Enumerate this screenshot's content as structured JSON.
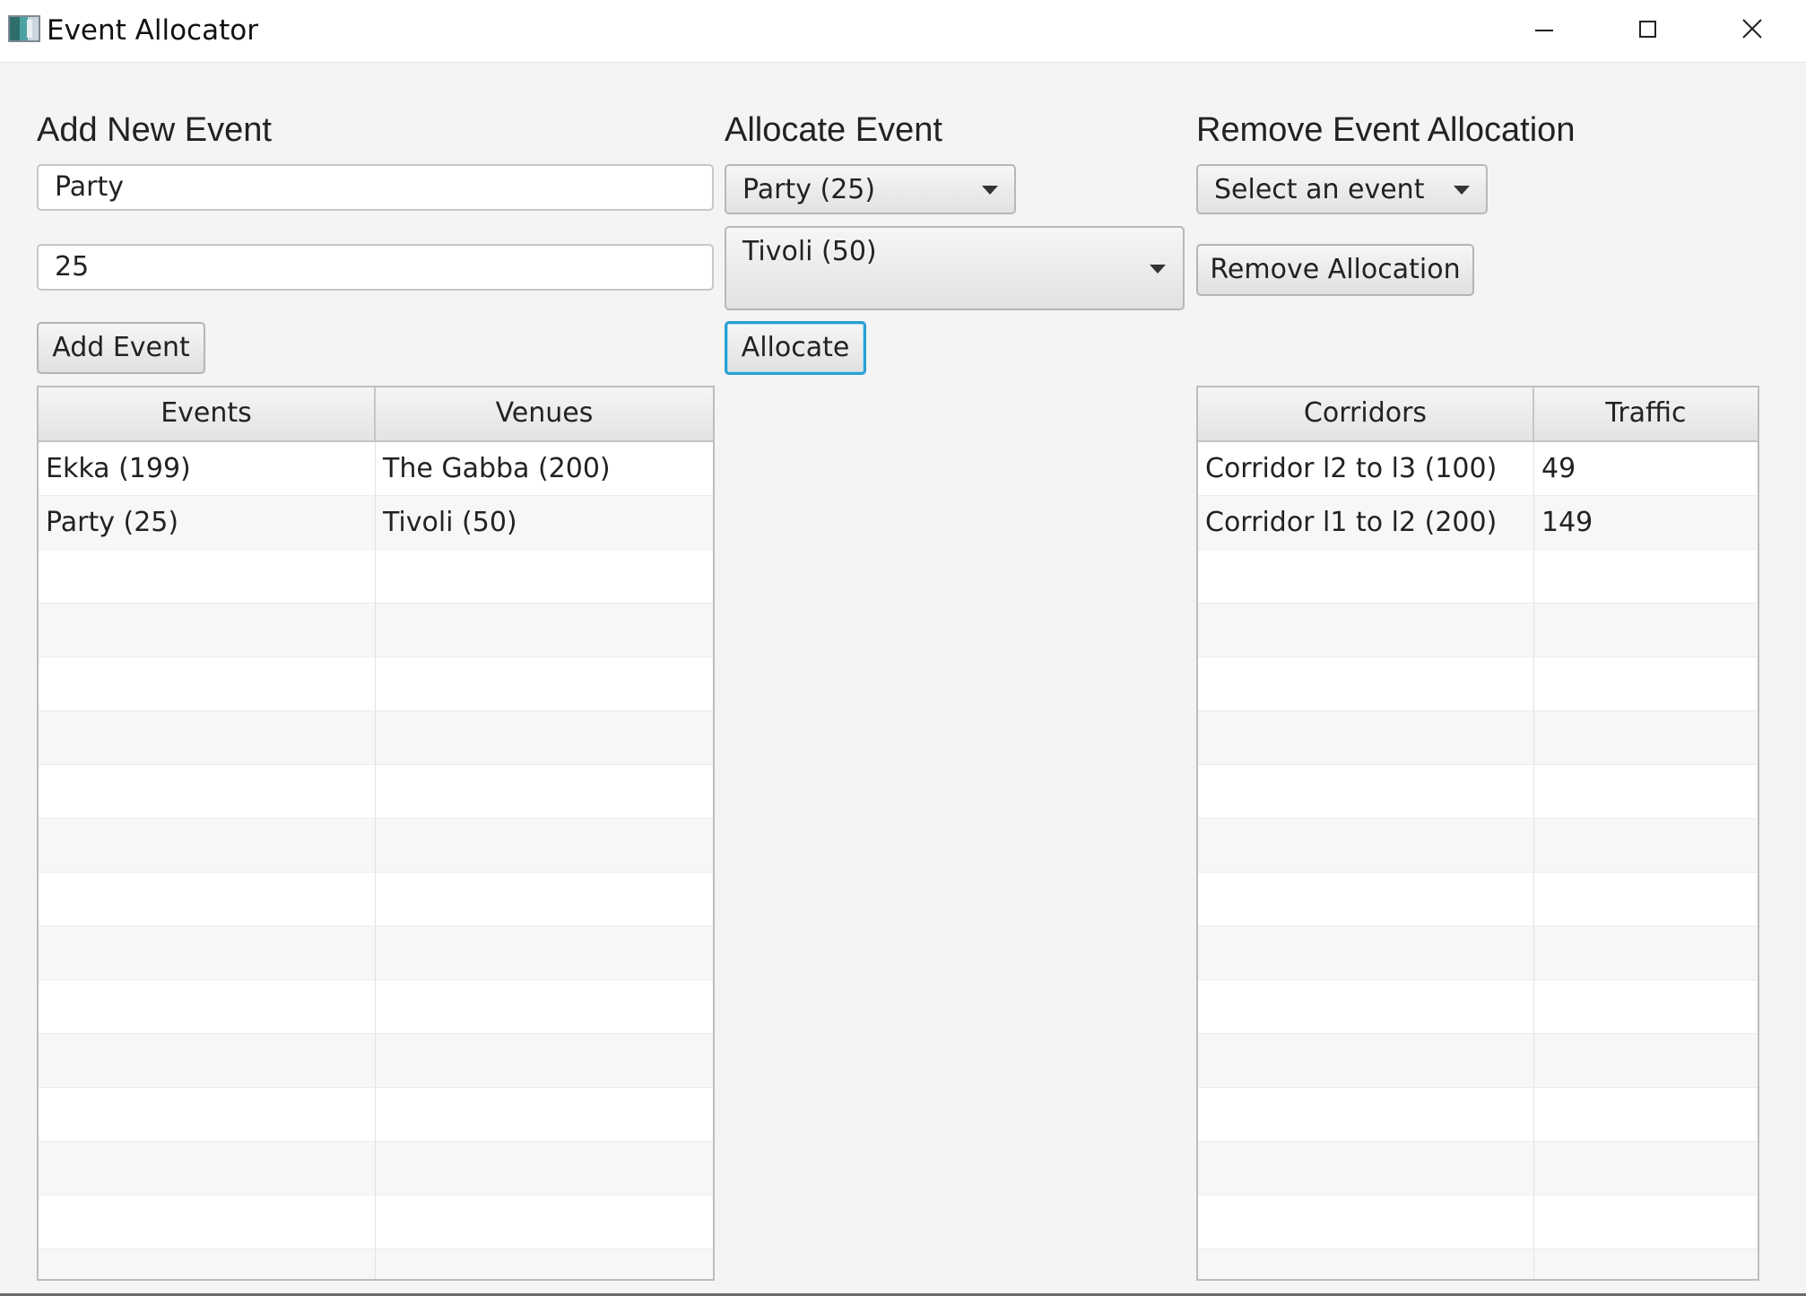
{
  "window": {
    "title": "Event Allocator",
    "controls": {
      "minimize": "minimize-icon",
      "maximize": "maximize-icon",
      "close": "close-icon"
    }
  },
  "add_event": {
    "title": "Add New Event",
    "name_value": "Party",
    "size_value": "25",
    "button_label": "Add Event"
  },
  "allocate_event": {
    "title": "Allocate Event",
    "event_selected": "Party (25)",
    "venue_selected": "Tivoli (50)",
    "button_label": "Allocate"
  },
  "remove_allocation": {
    "title": "Remove Event Allocation",
    "event_selected": "Select an event",
    "button_label": "Remove Allocation"
  },
  "events_table": {
    "columns": [
      "Events",
      "Venues"
    ],
    "rows": [
      [
        "Ekka (199)",
        "The Gabba (200)"
      ],
      [
        "Party (25)",
        "Tivoli (50)"
      ]
    ]
  },
  "traffic_table": {
    "columns": [
      "Corridors",
      "Traffic"
    ],
    "rows": [
      [
        "Corridor l2 to l3 (100)",
        "49"
      ],
      [
        "Corridor l1 to l2 (200)",
        "149"
      ]
    ]
  },
  "colors": {
    "focus": "#27a0d3",
    "background": "#f4f4f4"
  }
}
